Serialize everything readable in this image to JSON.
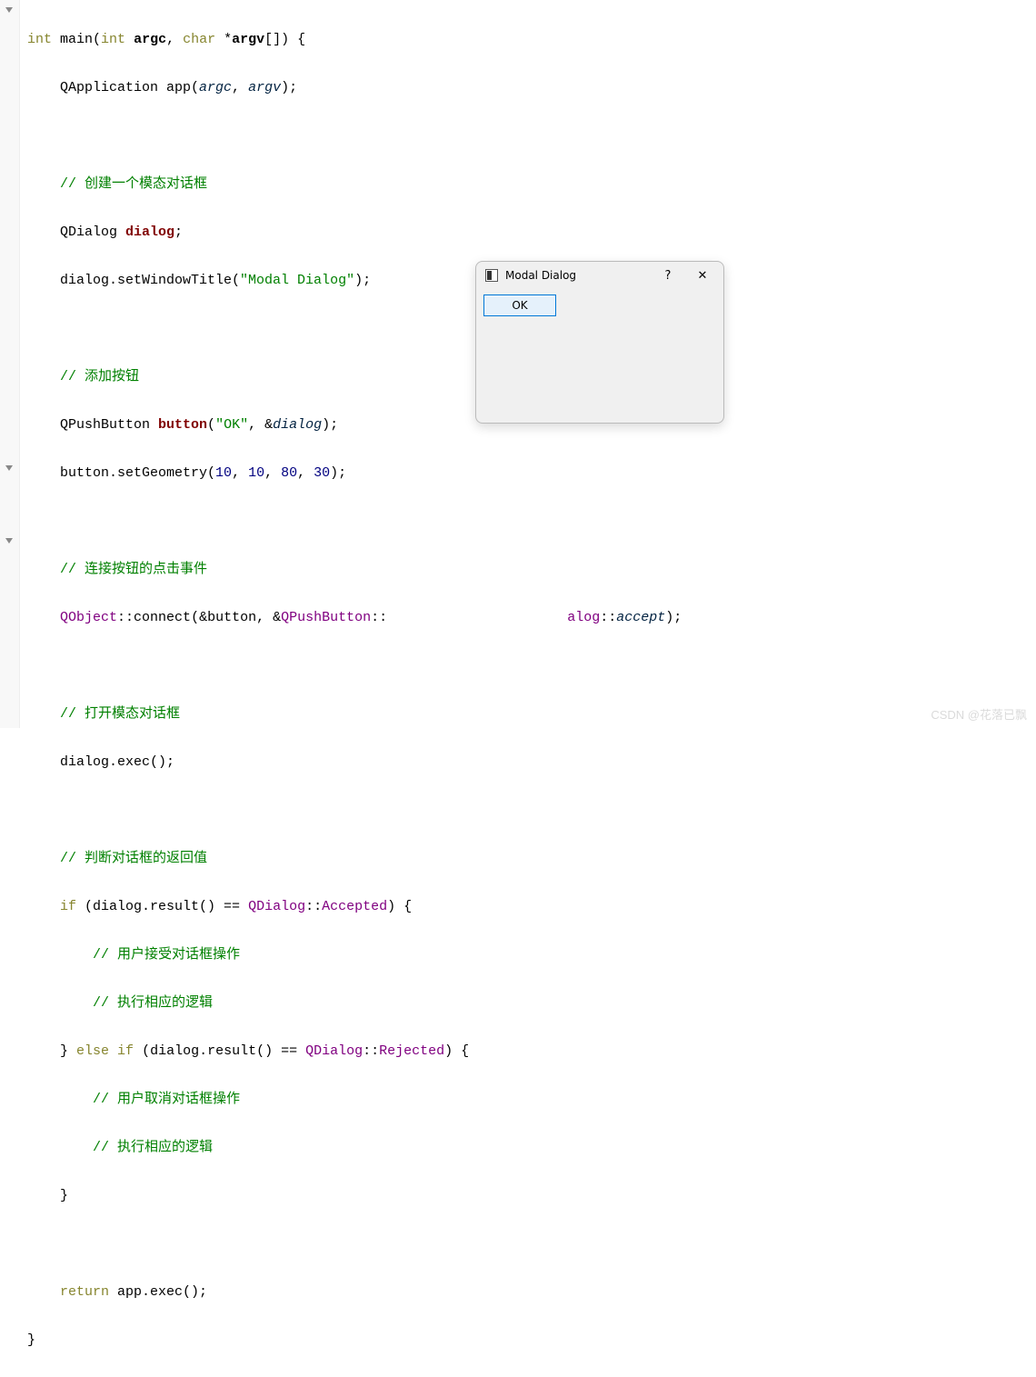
{
  "code": {
    "l1a": "int",
    "l1b": " main(",
    "l1c": "int",
    "l1d": " ",
    "l1e": "argc",
    "l1f": ", ",
    "l1g": "char",
    "l1h": " *",
    "l1i": "argv",
    "l1j": "[]) {",
    "l2a": "    QApplication app(",
    "l2b": "argc",
    "l2c": ", ",
    "l2d": "argv",
    "l2e": ");",
    "l3": "",
    "l4": "    // 创建一个模态对话框",
    "l5a": "    QDialog ",
    "l5b": "dialog",
    "l5c": ";",
    "l6a": "    dialog.setWindowTitle(",
    "l6b": "\"Modal Dialog\"",
    "l6c": ");",
    "l7": "",
    "l8": "    // 添加按钮",
    "l9a": "    QPushButton ",
    "l9b": "button",
    "l9c": "(",
    "l9d": "\"OK\"",
    "l9e": ", &",
    "l9f": "dialog",
    "l9g": ");",
    "l10a": "    button.setGeometry(",
    "l10b": "10",
    "l10c": ", ",
    "l10d": "10",
    "l10e": ", ",
    "l10f": "80",
    "l10g": ", ",
    "l10h": "30",
    "l10i": ");",
    "l11": "",
    "l12": "    // 连接按钮的点击事件",
    "l13a": "    QObject",
    "l13b": "::",
    "l13c": "connect",
    "l13d": "(&button, &",
    "l13e": "QPushButton",
    "l13f": "::",
    "l13g": "                      ",
    "l13h": "alog",
    "l13i": "::",
    "l13j": "accept",
    "l13k": ");",
    "l14": "",
    "l15": "    // 打开模态对话框",
    "l16": "    dialog.exec();",
    "l17": "",
    "l18": "    // 判断对话框的返回值",
    "l19a": "    ",
    "l19b": "if",
    "l19c": " (dialog.result() == ",
    "l19d": "QDialog",
    "l19e": "::",
    "l19f": "Accepted",
    "l19g": ") {",
    "l20": "        // 用户接受对话框操作",
    "l21": "        // 执行相应的逻辑",
    "l22a": "    } ",
    "l22b": "else",
    "l22c": " ",
    "l22d": "if",
    "l22e": " (dialog.result() == ",
    "l22f": "QDialog",
    "l22g": "::",
    "l22h": "Rejected",
    "l22i": ") {",
    "l23": "        // 用户取消对话框操作",
    "l24": "        // 执行相应的逻辑",
    "l25": "    }",
    "l26": "",
    "l27a": "    ",
    "l27b": "return",
    "l27c": " app.exec();",
    "l28": "}"
  },
  "modal": {
    "title": "Modal Dialog",
    "help": "?",
    "close": "✕",
    "ok": "OK"
  },
  "watermark": "CSDN @花落已飘"
}
